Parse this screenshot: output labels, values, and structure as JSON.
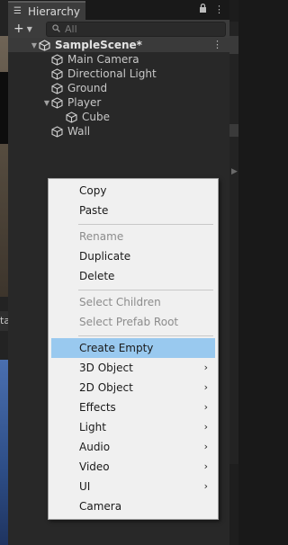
{
  "hierarchy": {
    "tab_title": "Hierarchy",
    "search_placeholder": "All",
    "scene": {
      "name": "SampleScene*"
    },
    "objects": [
      {
        "label": "Main Camera",
        "indent": 1,
        "foldable": false
      },
      {
        "label": "Directional Light",
        "indent": 1,
        "foldable": false
      },
      {
        "label": "Ground",
        "indent": 1,
        "foldable": false
      },
      {
        "label": "Player",
        "indent": 1,
        "foldable": true
      },
      {
        "label": "Cube",
        "indent": 2,
        "foldable": false
      },
      {
        "label": "Wall",
        "indent": 1,
        "foldable": false
      }
    ]
  },
  "left_panel": {
    "tab_fragment": "ta"
  },
  "context_menu": {
    "highlight_color": "#99c9ef",
    "items": [
      {
        "label": "Copy",
        "disabled": false
      },
      {
        "label": "Paste",
        "disabled": false
      },
      {
        "label": "Rename",
        "disabled": true
      },
      {
        "label": "Duplicate",
        "disabled": false
      },
      {
        "label": "Delete",
        "disabled": false
      },
      {
        "label": "Select Children",
        "disabled": true
      },
      {
        "label": "Select Prefab Root",
        "disabled": true
      },
      {
        "label": "Create Empty",
        "disabled": false,
        "highlighted": true
      },
      {
        "label": "3D Object",
        "submenu": true
      },
      {
        "label": "2D Object",
        "submenu": true
      },
      {
        "label": "Effects",
        "submenu": true
      },
      {
        "label": "Light",
        "submenu": true
      },
      {
        "label": "Audio",
        "submenu": true
      },
      {
        "label": "Video",
        "submenu": true
      },
      {
        "label": "UI",
        "submenu": true
      },
      {
        "label": "Camera",
        "submenu": false
      }
    ]
  },
  "icons": {
    "tab": "list-icon",
    "lock": "lock-icon",
    "menu": "kebab-menu-icon",
    "add": "plus-icon",
    "search": "search-icon",
    "scene": "unity-scene-icon",
    "gameobject": "cube-outline-icon",
    "submenu": "chevron-right-icon"
  }
}
